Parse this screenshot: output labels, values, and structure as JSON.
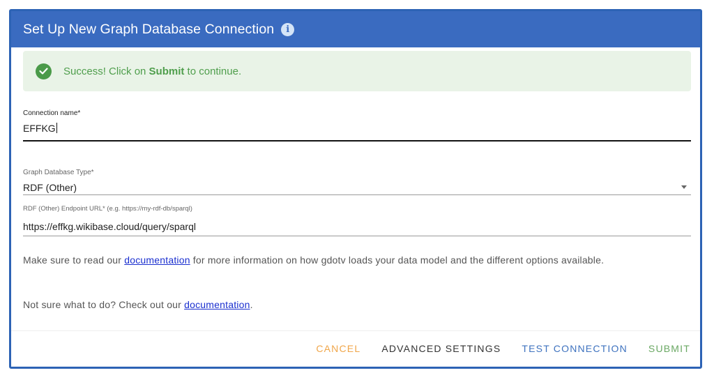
{
  "dialog": {
    "title": "Set Up New Graph Database Connection",
    "info_icon": "i"
  },
  "alert": {
    "icon": "check-circle-icon",
    "prefix": "Success! Click on ",
    "emphasis": "Submit",
    "suffix": " to continue."
  },
  "connection_name": {
    "label": "Connection name*",
    "value": "EFFKG"
  },
  "db_type": {
    "label": "Graph Database Type*",
    "value": "RDF (Other)"
  },
  "endpoint": {
    "label": "RDF (Other) Endpoint URL* (e.g. https://my-rdf-db/sparql)",
    "value": "https://effkg.wikibase.cloud/query/sparql"
  },
  "help1": {
    "before": "Make sure to read our ",
    "link": "documentation",
    "after": " for more information on how gdotv loads your data model and the different options available."
  },
  "help2": {
    "before": "Not sure what to do? Check out our ",
    "link": "documentation",
    "after": "."
  },
  "footer": {
    "cancel": "CANCEL",
    "advanced": "ADVANCED SETTINGS",
    "test": "TEST CONNECTION",
    "submit": "SUBMIT"
  },
  "colors": {
    "header": "#3a6bc0",
    "success": "#4a9a49",
    "cancel": "#f0a64a",
    "test": "#3e72bf",
    "submit": "#6aa863",
    "link": "#1a2fcf"
  }
}
